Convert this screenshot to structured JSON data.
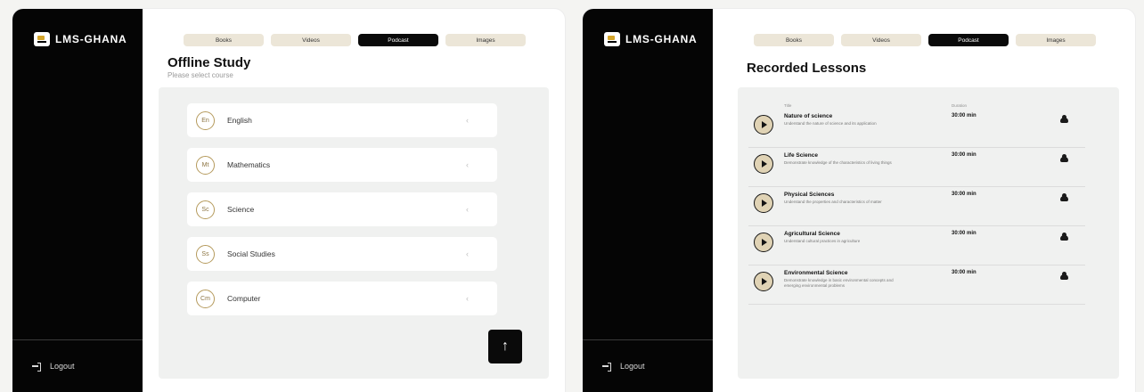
{
  "app": {
    "logo_text": "LMS-GHANA",
    "logout_label": "Logout"
  },
  "tabs": [
    {
      "label": "Books",
      "active": false
    },
    {
      "label": "Videos",
      "active": false
    },
    {
      "label": "Podcast",
      "active": true
    },
    {
      "label": "Images",
      "active": false
    }
  ],
  "offline": {
    "title": "Offline Study",
    "subtitle": "Please select course",
    "courses": [
      {
        "code": "En",
        "name": "English"
      },
      {
        "code": "Mt",
        "name": "Mathematics"
      },
      {
        "code": "Sc",
        "name": "Science"
      },
      {
        "code": "Ss",
        "name": "Social Studies"
      },
      {
        "code": "Cm",
        "name": "Computer"
      }
    ],
    "chevron": "‹",
    "fab_icon": "↑"
  },
  "recorded": {
    "title": "Recorded Lessons",
    "headers": {
      "title": "Title",
      "duration": "Duration"
    },
    "lessons": [
      {
        "title": "Nature of science",
        "desc": "Understand the nature of science and its application",
        "duration": "30:00 min"
      },
      {
        "title": "Life Science",
        "desc": "Demonstrate knowledge of the characteristics of living things",
        "duration": "30:00 min"
      },
      {
        "title": "Physical Sciences",
        "desc": "Understand the properties and characteristics of matter",
        "duration": "30:00 min"
      },
      {
        "title": "Agricultural Science",
        "desc": "Understand cultural practices in agriculture",
        "duration": "30:00 min"
      },
      {
        "title": "Environmental Science",
        "desc": "Demonstrate knowledge in basic environmental concepts and emerging environmental problems",
        "duration": "30:00 min"
      }
    ]
  },
  "colors": {
    "sidebar": "#050505",
    "accent": "#b59a5c",
    "tab_bg": "#ece6d8",
    "active_tab": "#0a0a0a"
  },
  "icons": [
    "logo-icon",
    "logout-icon",
    "chevron-left-icon",
    "arrow-up-icon",
    "play-icon",
    "cloud-download-icon"
  ]
}
